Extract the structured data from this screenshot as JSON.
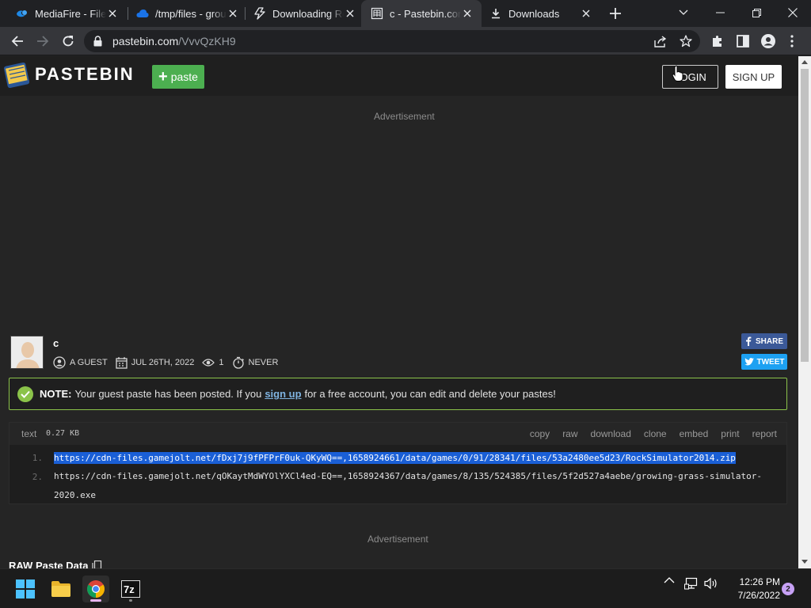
{
  "browser": {
    "tabs": [
      {
        "title": "MediaFire - File",
        "icon": "mediafire-icon"
      },
      {
        "title": "/tmp/files - grou",
        "icon": "cloud-icon"
      },
      {
        "title": "Downloading Ro",
        "icon": "lightning-icon"
      },
      {
        "title": "c - Pastebin.com",
        "icon": "pastebin-icon",
        "active": true
      },
      {
        "title": "Downloads",
        "icon": "download-icon"
      }
    ],
    "address": {
      "host": "pastebin.com",
      "path": "/VvvQzKH9"
    }
  },
  "header": {
    "logo_text": "PASTEBIN",
    "paste_label": "paste",
    "login_label": "LOGIN",
    "signup_label": "SIGN UP"
  },
  "ad_top": "Advertisement",
  "paste": {
    "title": "c",
    "author": "A GUEST",
    "date": "JUL 26TH, 2022",
    "views": "1",
    "expires": "NEVER",
    "share_label": "SHARE",
    "tweet_label": "TWEET"
  },
  "notice": {
    "strong": "NOTE:",
    "before": "Your guest paste has been posted. If you",
    "link": "sign up",
    "after": "for a free account, you can edit and delete your pastes!"
  },
  "code": {
    "syntax": "text",
    "size": "0.27 KB",
    "actions": [
      "copy",
      "raw",
      "download",
      "clone",
      "embed",
      "print",
      "report"
    ],
    "lines": [
      {
        "num": "1.",
        "text": "https://cdn-files.gamejolt.net/fDxj7j9fPFPrF0uk-QKyWQ==,1658924661/data/games/0/91/28341/files/53a2480ee5d23/RockSimulator2014.zip"
      },
      {
        "num": "2.",
        "text": "https://cdn-files.gamejolt.net/qOKaytMdWYOlYXCl4ed-EQ==,1658924367/data/games/8/135/524385/files/5f2d527a4aebe/growing-grass-simulator-",
        "cont": "2020.exe"
      }
    ]
  },
  "ad_bottom": "Advertisement",
  "raw_title": "RAW Paste Data",
  "taskbar": {
    "time": "12:26 PM",
    "date": "7/26/2022",
    "notifications": "2",
    "apps": [
      "windows-start-icon",
      "file-explorer-icon",
      "chrome-icon",
      "7zip-icon"
    ]
  },
  "colors": {
    "accent_green": "#4caf50",
    "notice_border": "#8bc34a",
    "selection": "#1a5fd6",
    "facebook": "#3b5998",
    "twitter": "#1da1f2"
  }
}
